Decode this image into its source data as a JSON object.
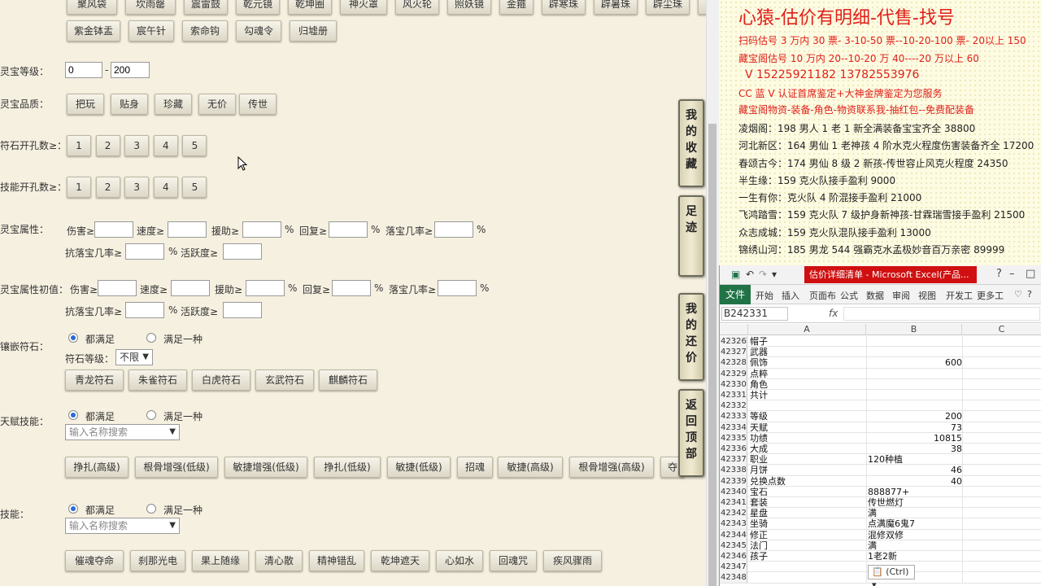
{
  "top_row_buttons": [
    "聚风袋",
    "坎雨罄",
    "震雷鼓",
    "乾元镜",
    "乾坤圈",
    "神火罩",
    "风火轮",
    "照妖镜",
    "金箍",
    "辟寒珠",
    "辟暑珠",
    "辟尘珠"
  ],
  "second_row_buttons": [
    "紫金钵盂",
    "宸午针",
    "索命钩",
    "勾魂令",
    "归墟册"
  ],
  "level": {
    "label": "灵宝等级：",
    "min": "0",
    "sep": "-",
    "max": "200"
  },
  "quality": {
    "label": "灵宝品质：",
    "options": [
      "把玩",
      "贴身",
      "珍藏",
      "无价",
      "传世"
    ]
  },
  "rune_holes": {
    "label": "符石开孔数≥：",
    "options": [
      "1",
      "2",
      "3",
      "4",
      "5"
    ]
  },
  "skill_holes": {
    "label": "技能开孔数≥：",
    "options": [
      "1",
      "2",
      "3",
      "4",
      "5"
    ]
  },
  "attrs": {
    "label": "灵宝属性：",
    "damage": "伤害≥",
    "speed": "速度≥",
    "assist": "援助≥",
    "pct": "%",
    "recover": "回复≥",
    "drop": "落宝几率≥",
    "anti_drop": "抗落宝几率≥",
    "activity": "活跃度≥"
  },
  "init_attrs": {
    "label": "灵宝属性初值："
  },
  "inlay_rune": {
    "label": "镶嵌符石：",
    "all": "都满足",
    "any": "满足一种",
    "level_label": "符石等级：",
    "level_value": "不限",
    "options": [
      "青龙符石",
      "朱雀符石",
      "白虎符石",
      "玄武符石",
      "麒麟符石"
    ]
  },
  "talent": {
    "label": "天赋技能：",
    "all": "都满足",
    "any": "满足一种",
    "placeholder": "输入名称搜索",
    "options": [
      "挣扎(高级)",
      "根骨增强(低级)",
      "敏捷增强(低级)",
      "挣扎(低级)",
      "敏捷(低级)",
      "招魂",
      "敏捷(高级)",
      "根骨增强(高级)",
      "夺"
    ]
  },
  "skill": {
    "label": "技能：",
    "all": "都满足",
    "any": "满足一种",
    "placeholder": "输入名称搜索",
    "options": [
      "催魂夺命",
      "刹那光电",
      "果上随缘",
      "清心散",
      "精神错乱",
      "乾坤遮天",
      "心如水",
      "回魂咒",
      "疾风骤雨"
    ]
  },
  "side_tabs": [
    [
      "我",
      "的",
      "收",
      "藏"
    ],
    [
      "足",
      "迹"
    ],
    [
      "我",
      "的",
      "还",
      "价"
    ],
    [
      "返",
      "回",
      "顶",
      "部"
    ]
  ],
  "ad": {
    "title": "心猿-估价有明细-代售-找号",
    "lines": [
      {
        "text": "扫码估号 3 万内 30 票- 3-10-50 票--10-20-100 票- 20以上 150",
        "color": "red"
      },
      {
        "text": "藏宝阁估号 10 万内 20--10-20 万 40----20 万以上 60",
        "color": "red"
      },
      {
        "text": "V 15225921182    13782553976",
        "color": "red",
        "big": true
      },
      {
        "text": "CC 蓝 V 认证首席鉴定+大神金牌鉴定为您服务",
        "color": "red"
      },
      {
        "text": "藏宝阁物资-装备-角色-物资联系我-抽红包--免费配装备",
        "color": "red"
      },
      {
        "text": "凌烟阁：198 男人 1 老 1 新全满装备宝宝齐全 38800",
        "color": "black"
      },
      {
        "text": "河北新区：164 男仙 1 老神孩 4 阶水克火程度伤害装备齐全 17200",
        "color": "black"
      },
      {
        "text": "春颂古今：174 男仙 8 级 2 新孩-传世容止风克火程度 24350",
        "color": "black"
      },
      {
        "text": "半生缘：159 克火队接手盈利 9000",
        "color": "black"
      },
      {
        "text": "一生有你：克火队 4 阶混接手盈利 21000",
        "color": "black"
      },
      {
        "text": "飞鸿踏雪：159 克火队 7 级护身新神孩-甘霖瑞雪接手盈利 21500",
        "color": "black"
      },
      {
        "text": "众志成城：159 克火队混队接手盈利 13000",
        "color": "black"
      },
      {
        "text": "锦绣山河：185 男龙 544 强霸克水孟极妙音百万亲密 89999",
        "color": "black"
      }
    ]
  },
  "excel": {
    "title_bar": "估价详细清单 - Microsoft Excel(产品...",
    "tabs": [
      "文件",
      "开始",
      "插入",
      "页面布",
      "公式",
      "数据",
      "审阅",
      "视图",
      "开发工",
      "更多工"
    ],
    "name_box": "B242331",
    "fx": "fx",
    "columns": [
      "A",
      "B",
      "C"
    ],
    "rows": [
      {
        "n": "42326",
        "a": "帽子",
        "b": ""
      },
      {
        "n": "42327",
        "a": "武器",
        "b": ""
      },
      {
        "n": "42328",
        "a": "佩饰",
        "b": "600"
      },
      {
        "n": "42329",
        "a": "点粹",
        "b": ""
      },
      {
        "n": "42330",
        "a": "角色",
        "b": ""
      },
      {
        "n": "42331",
        "a": "共计",
        "b": ""
      },
      {
        "n": "42332",
        "a": "",
        "b": ""
      },
      {
        "n": "42333",
        "a": "等级",
        "b": "200"
      },
      {
        "n": "42334",
        "a": "天赋",
        "b": "73"
      },
      {
        "n": "42335",
        "a": "功绩",
        "b": "10815"
      },
      {
        "n": "42336",
        "a": "大成",
        "b": "38"
      },
      {
        "n": "42337",
        "a": "职业",
        "b": "120种植",
        "left": true
      },
      {
        "n": "42338",
        "a": "月饼",
        "b": "46"
      },
      {
        "n": "42339",
        "a": "兑换点数",
        "b": "40"
      },
      {
        "n": "42340",
        "a": "宝石",
        "b": "888877+",
        "left": true
      },
      {
        "n": "42341",
        "a": "套装",
        "b": "传世燃灯",
        "left": true
      },
      {
        "n": "42342",
        "a": "星盘",
        "b": "满",
        "left": true
      },
      {
        "n": "42343",
        "a": "坐骑",
        "b": "点满魔6鬼7",
        "left": true
      },
      {
        "n": "42344",
        "a": "修正",
        "b": "混修双修",
        "left": true
      },
      {
        "n": "42345",
        "a": "法门",
        "b": "满",
        "left": true
      },
      {
        "n": "42346",
        "a": "孩子",
        "b": "1老2新",
        "left": true
      },
      {
        "n": "42347",
        "a": "",
        "b": ""
      },
      {
        "n": "42348",
        "a": "",
        "b": ""
      }
    ],
    "paste_tag": "(Ctrl)"
  },
  "colors": {
    "panel_bg": "#f6f0e0",
    "ad_red": "#e0201a",
    "excel_green": "#217346",
    "excel_title_red": "#d01010"
  }
}
